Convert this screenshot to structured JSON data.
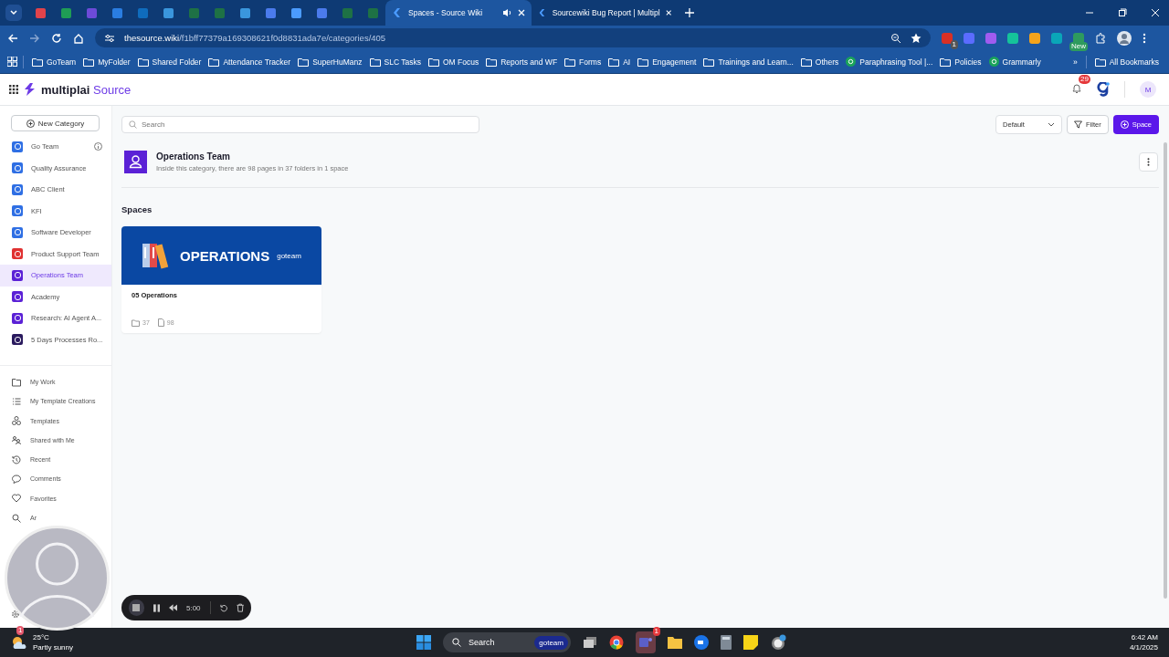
{
  "browser": {
    "pinned_tabs": [
      {
        "color": "#e0434b"
      },
      {
        "color": "#1f9d55"
      },
      {
        "color": "#6d4bd8"
      },
      {
        "color": "#2a7de1"
      },
      {
        "color": "#0f6cbd"
      },
      {
        "color": "#3a96dd"
      },
      {
        "color": "#1e7145"
      },
      {
        "color": "#1e7145"
      },
      {
        "color": "#3a96dd"
      },
      {
        "color": "#4b7bec"
      },
      {
        "color": "#4b9bff"
      },
      {
        "color": "#4b7bec"
      },
      {
        "color": "#1e7145"
      },
      {
        "color": "#1e7145"
      }
    ],
    "tabs": [
      {
        "title": "Spaces - Source Wiki",
        "selected": true,
        "audio": true
      },
      {
        "title": "Sourcewiki Bug Report | Multipl",
        "selected": false,
        "audio": false
      }
    ],
    "url_host": "thesource.wiki",
    "url_path": "/f1bff77379a169308621f0d8831ada7e/categories/405",
    "extensions": [
      {
        "color": "#d93025",
        "badge": "1"
      },
      {
        "color": "#5b6cff"
      },
      {
        "color": "#a05cf0"
      },
      {
        "color": "#15c39a"
      },
      {
        "color": "#f4a31b"
      },
      {
        "color": "#0aa6b8"
      },
      {
        "color": "#2e9b5e",
        "badge": "New"
      }
    ],
    "bookmarks": [
      {
        "kind": "folder",
        "label": "GoTeam"
      },
      {
        "kind": "folder",
        "label": "MyFolder"
      },
      {
        "kind": "folder",
        "label": "Shared Folder"
      },
      {
        "kind": "folder",
        "label": "Attendance Tracker"
      },
      {
        "kind": "folder",
        "label": "SuperHuManz"
      },
      {
        "kind": "folder",
        "label": "SLC Tasks"
      },
      {
        "kind": "folder",
        "label": "OM Focus"
      },
      {
        "kind": "folder",
        "label": "Reports and WF"
      },
      {
        "kind": "folder",
        "label": "Forms"
      },
      {
        "kind": "folder",
        "label": "AI"
      },
      {
        "kind": "folder",
        "label": "Engagement"
      },
      {
        "kind": "folder",
        "label": "Trainings and Learn..."
      },
      {
        "kind": "folder",
        "label": "Others"
      },
      {
        "kind": "site",
        "label": "Paraphrasing Tool |..."
      },
      {
        "kind": "folder",
        "label": "Policies"
      },
      {
        "kind": "site",
        "label": "Grammarly"
      }
    ],
    "more_bookmarks": "»",
    "all_bookmarks": "All Bookmarks"
  },
  "app": {
    "logo_word": "multiplai",
    "logo_product": "Source",
    "notifications": "29",
    "avatar": "M"
  },
  "sidebar": {
    "new_category": "New Category",
    "categories": [
      {
        "label": "Go Team",
        "color": "#2f6fe4",
        "selected": false,
        "info": true
      },
      {
        "label": "Quality Assurance",
        "color": "#2f6fe4",
        "selected": false,
        "info": false
      },
      {
        "label": "ABC Client",
        "color": "#2f6fe4",
        "selected": false,
        "info": false
      },
      {
        "label": "KFI",
        "color": "#2f6fe4",
        "selected": false,
        "info": false
      },
      {
        "label": "Software Developer",
        "color": "#2f6fe4",
        "selected": false,
        "info": false
      },
      {
        "label": "Product Support Team",
        "color": "#e03131",
        "selected": false,
        "info": false
      },
      {
        "label": "Operations Team",
        "color": "#5b21d6",
        "selected": true,
        "info": false
      },
      {
        "label": "Academy",
        "color": "#5b21d6",
        "selected": false,
        "info": false
      },
      {
        "label": "Research: AI Agent A...",
        "color": "#5b21d6",
        "selected": false,
        "info": false
      },
      {
        "label": "5 Days Processes Ro...",
        "color": "#2a1a5e",
        "selected": false,
        "info": false
      }
    ],
    "nav": [
      {
        "kind": "folder",
        "label": "My Work"
      },
      {
        "kind": "list",
        "label": "My Template Creations"
      },
      {
        "kind": "shapes",
        "label": "Templates"
      },
      {
        "kind": "people",
        "label": "Shared with Me"
      },
      {
        "kind": "history",
        "label": "Recent"
      },
      {
        "kind": "comment",
        "label": "Comments"
      },
      {
        "kind": "heart",
        "label": "Favorites"
      },
      {
        "kind": "search",
        "label": "Ar"
      }
    ]
  },
  "toolbar": {
    "search_placeholder": "Search",
    "sort": "Default",
    "filter": "Filter",
    "add": "Space"
  },
  "category": {
    "title": "Operations Team",
    "description": "Inside this category, there are 98 pages in 37 folders in 1 space"
  },
  "section_title": "Spaces",
  "spaces": [
    {
      "banner": "OPERATIONS",
      "banner_brand": "goteam",
      "title": "05 Operations",
      "folders": "37",
      "pages": "98"
    }
  ],
  "recorder": {
    "time": "5:00"
  },
  "taskbar": {
    "temperature": "25°C",
    "weather": "Partly sunny",
    "weather_badge": "1",
    "search": "Search",
    "search_brand": "goteam",
    "teams_badge": "1",
    "time": "6:42 AM",
    "date": "4/1/2025"
  }
}
